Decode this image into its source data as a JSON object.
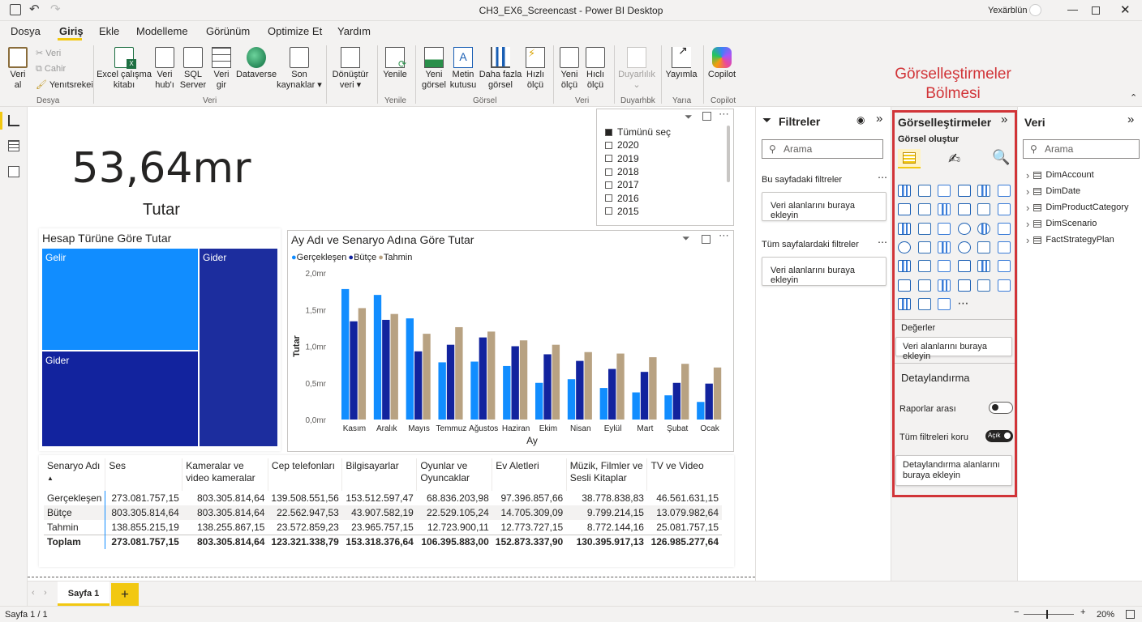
{
  "window": {
    "title": "CH3_EX6_Screencast - Power BI Desktop",
    "user": "Yexärblün"
  },
  "menu": [
    "Dosya",
    "Giriş",
    "Ekle",
    "Modelleme",
    "Görünüm",
    "Optimize Et",
    "Yardım"
  ],
  "ribbon": {
    "clipboard": {
      "paste": "Veri\nal",
      "cut": "Veri",
      "copy": "Cahir",
      "format": "Yenıtsrekei",
      "group": "Desya"
    },
    "data_buttons": [
      "Excel çalışma\nkitabı",
      "Veri\nhub'ı",
      "SQL\nServer",
      "Veri\ngir",
      "Dataverse",
      "Son\nkaynaklar ▾"
    ],
    "data_group": "Veri",
    "transform": "Dönüştür\nveri ▾",
    "refresh": "Yenile",
    "refresh_group": "Yenile",
    "insert_buttons": [
      "Yeni\ngörsel",
      "Metin\nkutusu",
      "Daha fazla\ngörsel",
      "Hızlı\nölçü"
    ],
    "insert_group": "Görsel",
    "calc_buttons": [
      "Yeni\nölçü",
      "Hıclı\nölçü"
    ],
    "calc_group": "Veri",
    "sensitivity": "Duyarlılık\n⌄",
    "sensitivity_group": "Duyarhbk",
    "publish": "Yayımla",
    "publish_group": "Yarıa",
    "copilot": "Copilot",
    "copilot_group": "Copilot"
  },
  "annotation": "Görselleştirmeler\nBölmesi",
  "kpi": {
    "value": "53,64mr",
    "label": "Tutar"
  },
  "slicer": {
    "items": [
      "Tümünü seç",
      "2020",
      "2019",
      "2018",
      "2017",
      "2016",
      "2015"
    ]
  },
  "treemap": {
    "title": "Hesap Türüne Göre Tutar",
    "labels": [
      "Gelir",
      "Gider",
      "Gider"
    ]
  },
  "colors": {
    "accent": "#f2c811",
    "gercek": "#118dff",
    "butce": "#12239e",
    "tahmin": "#b8a282",
    "annot": "#d13438"
  },
  "chart_data": {
    "type": "bar",
    "title": "Ay Adı ve Senaryo Adına Göre Tutar",
    "xlabel": "Ay",
    "ylabel": "Tutar",
    "ylim": [
      0,
      2.0
    ],
    "yticks": [
      "2,0mr",
      "1,5mr",
      "1,0mr",
      "0,5mr",
      "0,0mr"
    ],
    "categories": [
      "Kasım",
      "Aralık",
      "Mayıs",
      "Temmuz",
      "Ağustos",
      "Haziran",
      "Ekim",
      "Nisan",
      "Eylül",
      "Mart",
      "Şubat",
      "Ocak"
    ],
    "series": [
      {
        "name": "Gerçekleşen",
        "values": [
          1.78,
          1.7,
          1.38,
          0.78,
          0.79,
          0.73,
          0.5,
          0.55,
          0.43,
          0.37,
          0.33,
          0.24
        ]
      },
      {
        "name": "Bütçe",
        "values": [
          1.34,
          1.36,
          0.93,
          1.02,
          1.12,
          1.0,
          0.89,
          0.8,
          0.69,
          0.65,
          0.5,
          0.49
        ]
      },
      {
        "name": "Tahmin",
        "values": [
          1.52,
          1.44,
          1.17,
          1.26,
          1.2,
          1.08,
          1.02,
          0.92,
          0.9,
          0.85,
          0.76,
          0.71
        ]
      }
    ],
    "legend": "top-left"
  },
  "matrix": {
    "headers": [
      "Senaryo Adı",
      "Ses",
      "Kameralar ve video kameralar",
      "Cep telefonları",
      "Bilgisayarlar",
      "Oyunlar ve Oyuncaklar",
      "Ev Aletleri",
      "Müzik, Filmler ve Sesli Kitaplar",
      "TV ve Video"
    ],
    "sort": "▲",
    "rows": [
      [
        "Gerçekleşen",
        "273.081.757,15",
        "803.305.814,64",
        "139.508.551,56",
        "153.512.597,47",
        "68.836.203,98",
        "97.396.857,66",
        "38.778.838,83",
        "46.561.631,15"
      ],
      [
        "Bütçe",
        "803.305.814,64",
        "803.305.814,64",
        "22.562.947,53",
        "43.907.582,19",
        "22.529.105,24",
        "14.705.309,09",
        "9.799.214,15",
        "13.079.982,64"
      ],
      [
        "Tahmin",
        "138.855.215,19",
        "138.255.867,15",
        "23.572.859,23",
        "23.965.757,15",
        "12.723.900,11",
        "12.773.727,15",
        "8.772.144,16",
        "25.081.757,15"
      ]
    ],
    "total": [
      "Toplam",
      "273.081.757,15",
      "803.305.814,64",
      "123.321.338,79",
      "153.318.376,64",
      "106.395.883,00",
      "152.873.337,90",
      "130.395.917,13",
      "126.985.277,64"
    ]
  },
  "filters": {
    "title": "Filtreler",
    "search": "Arama",
    "page_section": "Bu sayfadaki filtreler",
    "page_drop": "Veri alanlarını buraya ekleyin",
    "all_section": "Tüm sayfalardaki filtreler",
    "all_drop": "Veri alanlarını buraya ekleyin"
  },
  "viz": {
    "title": "Görselleştirmeler",
    "build": "Görsel oluştur",
    "values": "Değerler",
    "values_drop": "Veri alanlarını buraya ekleyin",
    "drill": "Detaylandırma",
    "cross": "Raporlar arası",
    "keep": "Tüm filtreleri koru",
    "keep_state": "Açık",
    "drill_drop": "Detaylandırma alanlarını buraya ekleyin"
  },
  "data_pane": {
    "title": "Veri",
    "search": "Arama",
    "tables": [
      "DimAccount",
      "DimDate",
      "DimProductCategory",
      "DimScenario",
      "FactStrategyPlan"
    ]
  },
  "tabs": {
    "page": "Sayfa 1",
    "add": "+"
  },
  "status": {
    "page": "Sayfa 1 / 1",
    "zoom": "20%"
  }
}
